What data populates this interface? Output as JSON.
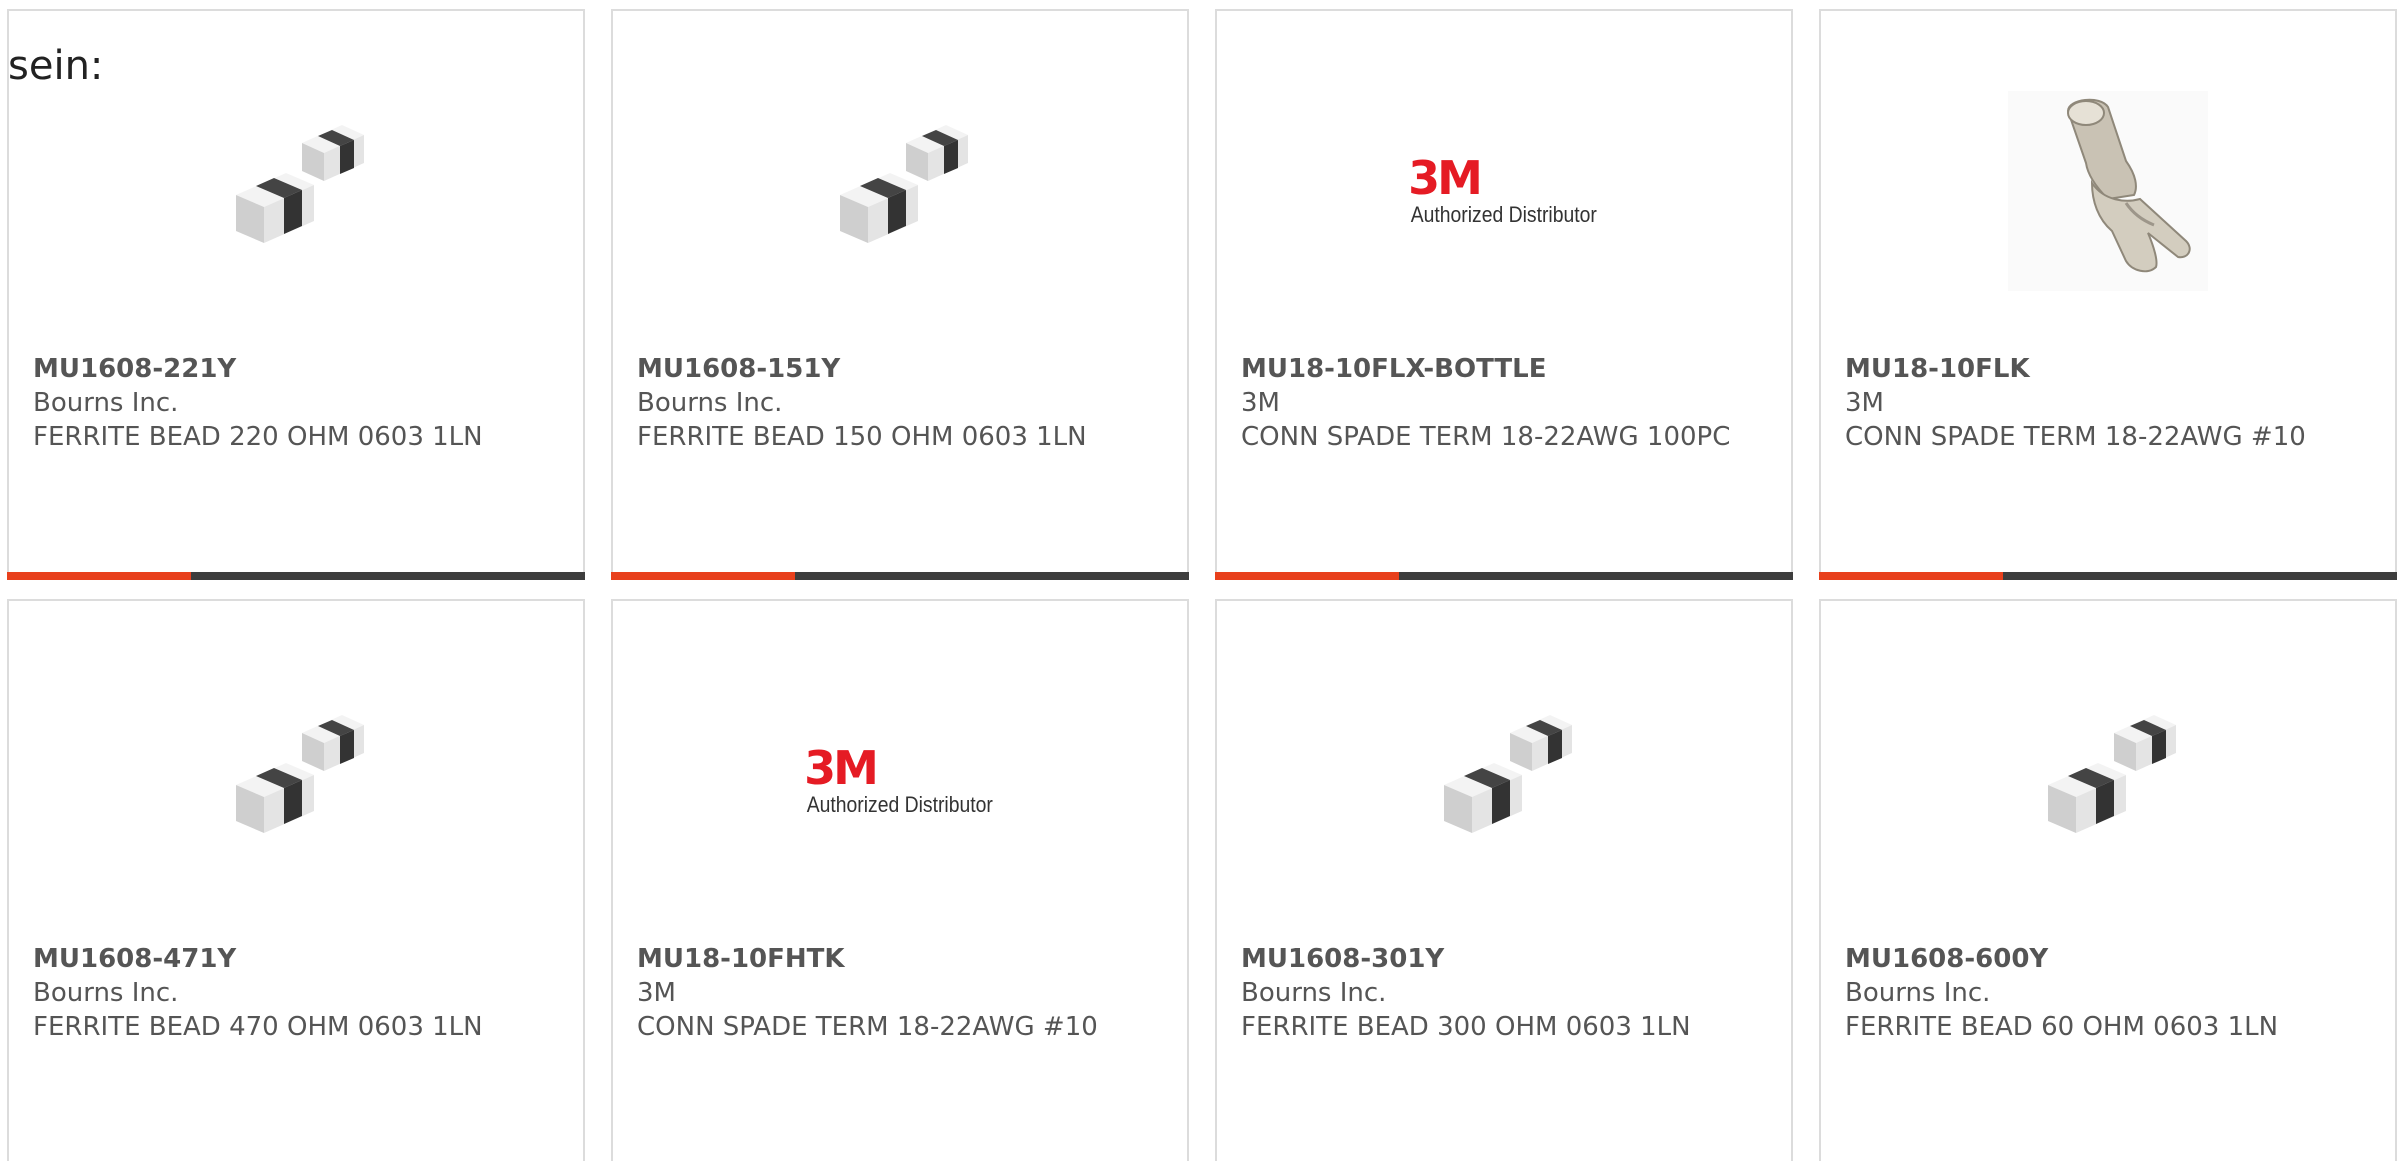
{
  "intro_text": "sein:",
  "colors": {
    "card_border": "#dcdcdc",
    "accent": "#e8401c",
    "bar": "#3d3d3d",
    "text": "#555555",
    "brand_red": "#e51b24"
  },
  "products": [
    {
      "part_number": "MU1608-221Y",
      "manufacturer": "Bourns Inc.",
      "description": "FERRITE BEAD 220 OHM 0603 1LN",
      "image": "ferrite-bead-chip-image"
    },
    {
      "part_number": "MU1608-151Y",
      "manufacturer": "Bourns Inc.",
      "description": "FERRITE BEAD 150 OHM 0603 1LN",
      "image": "ferrite-bead-chip-image"
    },
    {
      "part_number": "MU18-10FLX-BOTTLE",
      "manufacturer": "3M",
      "description": "CONN SPADE TERM 18-22AWG 100PC",
      "image": "3m-authorized-distributor-logo",
      "logo_mark": "3M",
      "logo_tag": "Authorized Distributor"
    },
    {
      "part_number": "MU18-10FLK",
      "manufacturer": "3M",
      "description": "CONN SPADE TERM 18-22AWG #10",
      "image": "spade-terminal-image"
    },
    {
      "part_number": "MU1608-471Y",
      "manufacturer": "Bourns Inc.",
      "description": "FERRITE BEAD 470 OHM 0603 1LN",
      "image": "ferrite-bead-chip-image"
    },
    {
      "part_number": "MU18-10FHTK",
      "manufacturer": "3M",
      "description": "CONN SPADE TERM 18-22AWG #10",
      "image": "3m-authorized-distributor-logo",
      "logo_mark": "3M",
      "logo_tag": "Authorized Distributor"
    },
    {
      "part_number": "MU1608-301Y",
      "manufacturer": "Bourns Inc.",
      "description": "FERRITE BEAD 300 OHM 0603 1LN",
      "image": "ferrite-bead-chip-image"
    },
    {
      "part_number": "MU1608-600Y",
      "manufacturer": "Bourns Inc.",
      "description": "FERRITE BEAD 60 OHM 0603 1LN",
      "image": "ferrite-bead-chip-image"
    }
  ]
}
